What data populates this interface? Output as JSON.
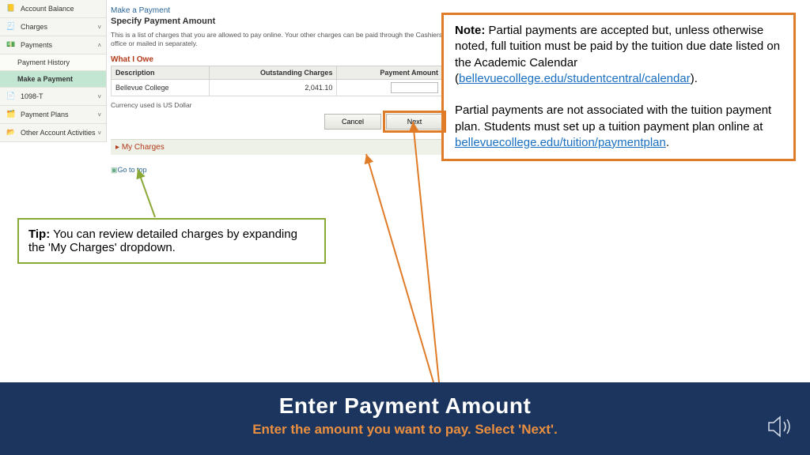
{
  "sidebar": {
    "items": [
      {
        "label": "Account Balance",
        "chev": ""
      },
      {
        "label": "Charges",
        "chev": "˅"
      },
      {
        "label": "Payments",
        "chev": "˄"
      },
      {
        "label": "Payment History",
        "sub": true
      },
      {
        "label": "Make a Payment",
        "sub": true,
        "active": true
      },
      {
        "label": "1098-T",
        "chev": "˅"
      },
      {
        "label": "Payment Plans",
        "chev": "˅"
      },
      {
        "label": "Other Account Activities",
        "chev": "˅"
      }
    ]
  },
  "main": {
    "crumb": "Make a Payment",
    "title": "Specify Payment Amount",
    "hint": "This is a list of charges that you are allowed to pay online. Your other charges can be paid through the Cashiers office or mailed in separately.",
    "owe_title": "What I Owe",
    "headers": {
      "desc": "Description",
      "out": "Outstanding Charges",
      "pay": "Payment Amount"
    },
    "row": {
      "desc": "Bellevue College",
      "out": "2,041.10",
      "pay": ""
    },
    "currency": "Currency used is US Dollar",
    "cancel": "Cancel",
    "next": "Next",
    "mycharges": "My Charges",
    "gotop": "Go to top"
  },
  "tip": {
    "label": "Tip:",
    "text": " You can review detailed charges by expanding the 'My Charges' dropdown."
  },
  "note": {
    "label": "Note:",
    "p1a": " Partial payments are accepted but, unless otherwise noted, full tuition must be paid by the tuition due date listed on the Academic Calendar (",
    "link1": "bellevuecollege.edu/studentcentral/calendar",
    "p1b": ").",
    "p2a": "Partial payments are not associated with the tuition payment plan. Students must set up a tuition payment plan online at ",
    "link2": "bellevuecollege.edu/tuition/paymentplan",
    "p2b": "."
  },
  "footer": {
    "title": "Enter Payment Amount",
    "sub": "Enter the amount you want to pay. Select 'Next'."
  }
}
